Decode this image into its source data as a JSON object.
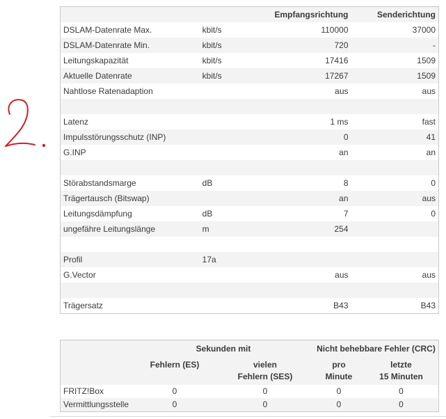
{
  "dsl": {
    "headers": {
      "rx": "Empfangsrichtung",
      "tx": "Senderichtung"
    },
    "rows": [
      {
        "label": "DSLAM-Datenrate Max.",
        "unit": "kbit/s",
        "rx": "110000",
        "tx": "37000"
      },
      {
        "label": "DSLAM-Datenrate Min.",
        "unit": "kbit/s",
        "rx": "720",
        "tx": "-"
      },
      {
        "label": "Leitungskapazität",
        "unit": "kbit/s",
        "rx": "17416",
        "tx": "1509"
      },
      {
        "label": "Aktuelle Datenrate",
        "unit": "kbit/s",
        "rx": "17267",
        "tx": "1509"
      },
      {
        "label": "Nahtlose Ratenadaption",
        "unit": "",
        "rx": "aus",
        "tx": "aus"
      },
      {
        "label": "",
        "unit": "",
        "rx": "",
        "tx": ""
      },
      {
        "label": "Latenz",
        "unit": "",
        "rx": "1 ms",
        "tx": "fast"
      },
      {
        "label": "Impulsstörungsschutz (INP)",
        "unit": "",
        "rx": "0",
        "tx": "41"
      },
      {
        "label": "G.INP",
        "unit": "",
        "rx": "an",
        "tx": "an"
      },
      {
        "label": "",
        "unit": "",
        "rx": "",
        "tx": ""
      },
      {
        "label": "Störabstandsmarge",
        "unit": "dB",
        "rx": "8",
        "tx": "0"
      },
      {
        "label": "Trägertausch (Bitswap)",
        "unit": "",
        "rx": "an",
        "tx": "aus"
      },
      {
        "label": "Leitungsdämpfung",
        "unit": "dB",
        "rx": "7",
        "tx": "0"
      },
      {
        "label": "ungefähre Leitungslänge",
        "unit": "m",
        "rx": "254",
        "tx": ""
      },
      {
        "label": "",
        "unit": "",
        "rx": "",
        "tx": ""
      },
      {
        "label": "Profil",
        "unit": "17a",
        "rx": "",
        "tx": ""
      },
      {
        "label": "G.Vector",
        "unit": "",
        "rx": "aus",
        "tx": "aus"
      },
      {
        "label": "",
        "unit": "",
        "rx": "",
        "tx": ""
      },
      {
        "label": "Trägersatz",
        "unit": "",
        "rx": "B43",
        "tx": "B43"
      }
    ]
  },
  "errors": {
    "group_seconds": "Sekunden mit",
    "group_crc": "Nicht behebbare Fehler (CRC)",
    "col_es": "Fehlern (ES)",
    "col_ses_1": "vielen",
    "col_ses_2": "Fehlern (SES)",
    "col_pm_1": "pro",
    "col_pm_2": "Minute",
    "col_15_1": "letzte",
    "col_15_2": "15 Minuten",
    "rows": [
      {
        "label": "FRITZ!Box",
        "es": "0",
        "ses": "0",
        "pm": "0",
        "m15": "0"
      },
      {
        "label": "Vermittlungsstelle",
        "es": "0",
        "ses": "0",
        "pm": "0",
        "m15": "0"
      }
    ]
  },
  "colors": {
    "handwriting": "#d0202a",
    "row_stripe": "#f3f3f3",
    "border": "#c8c8c8"
  }
}
